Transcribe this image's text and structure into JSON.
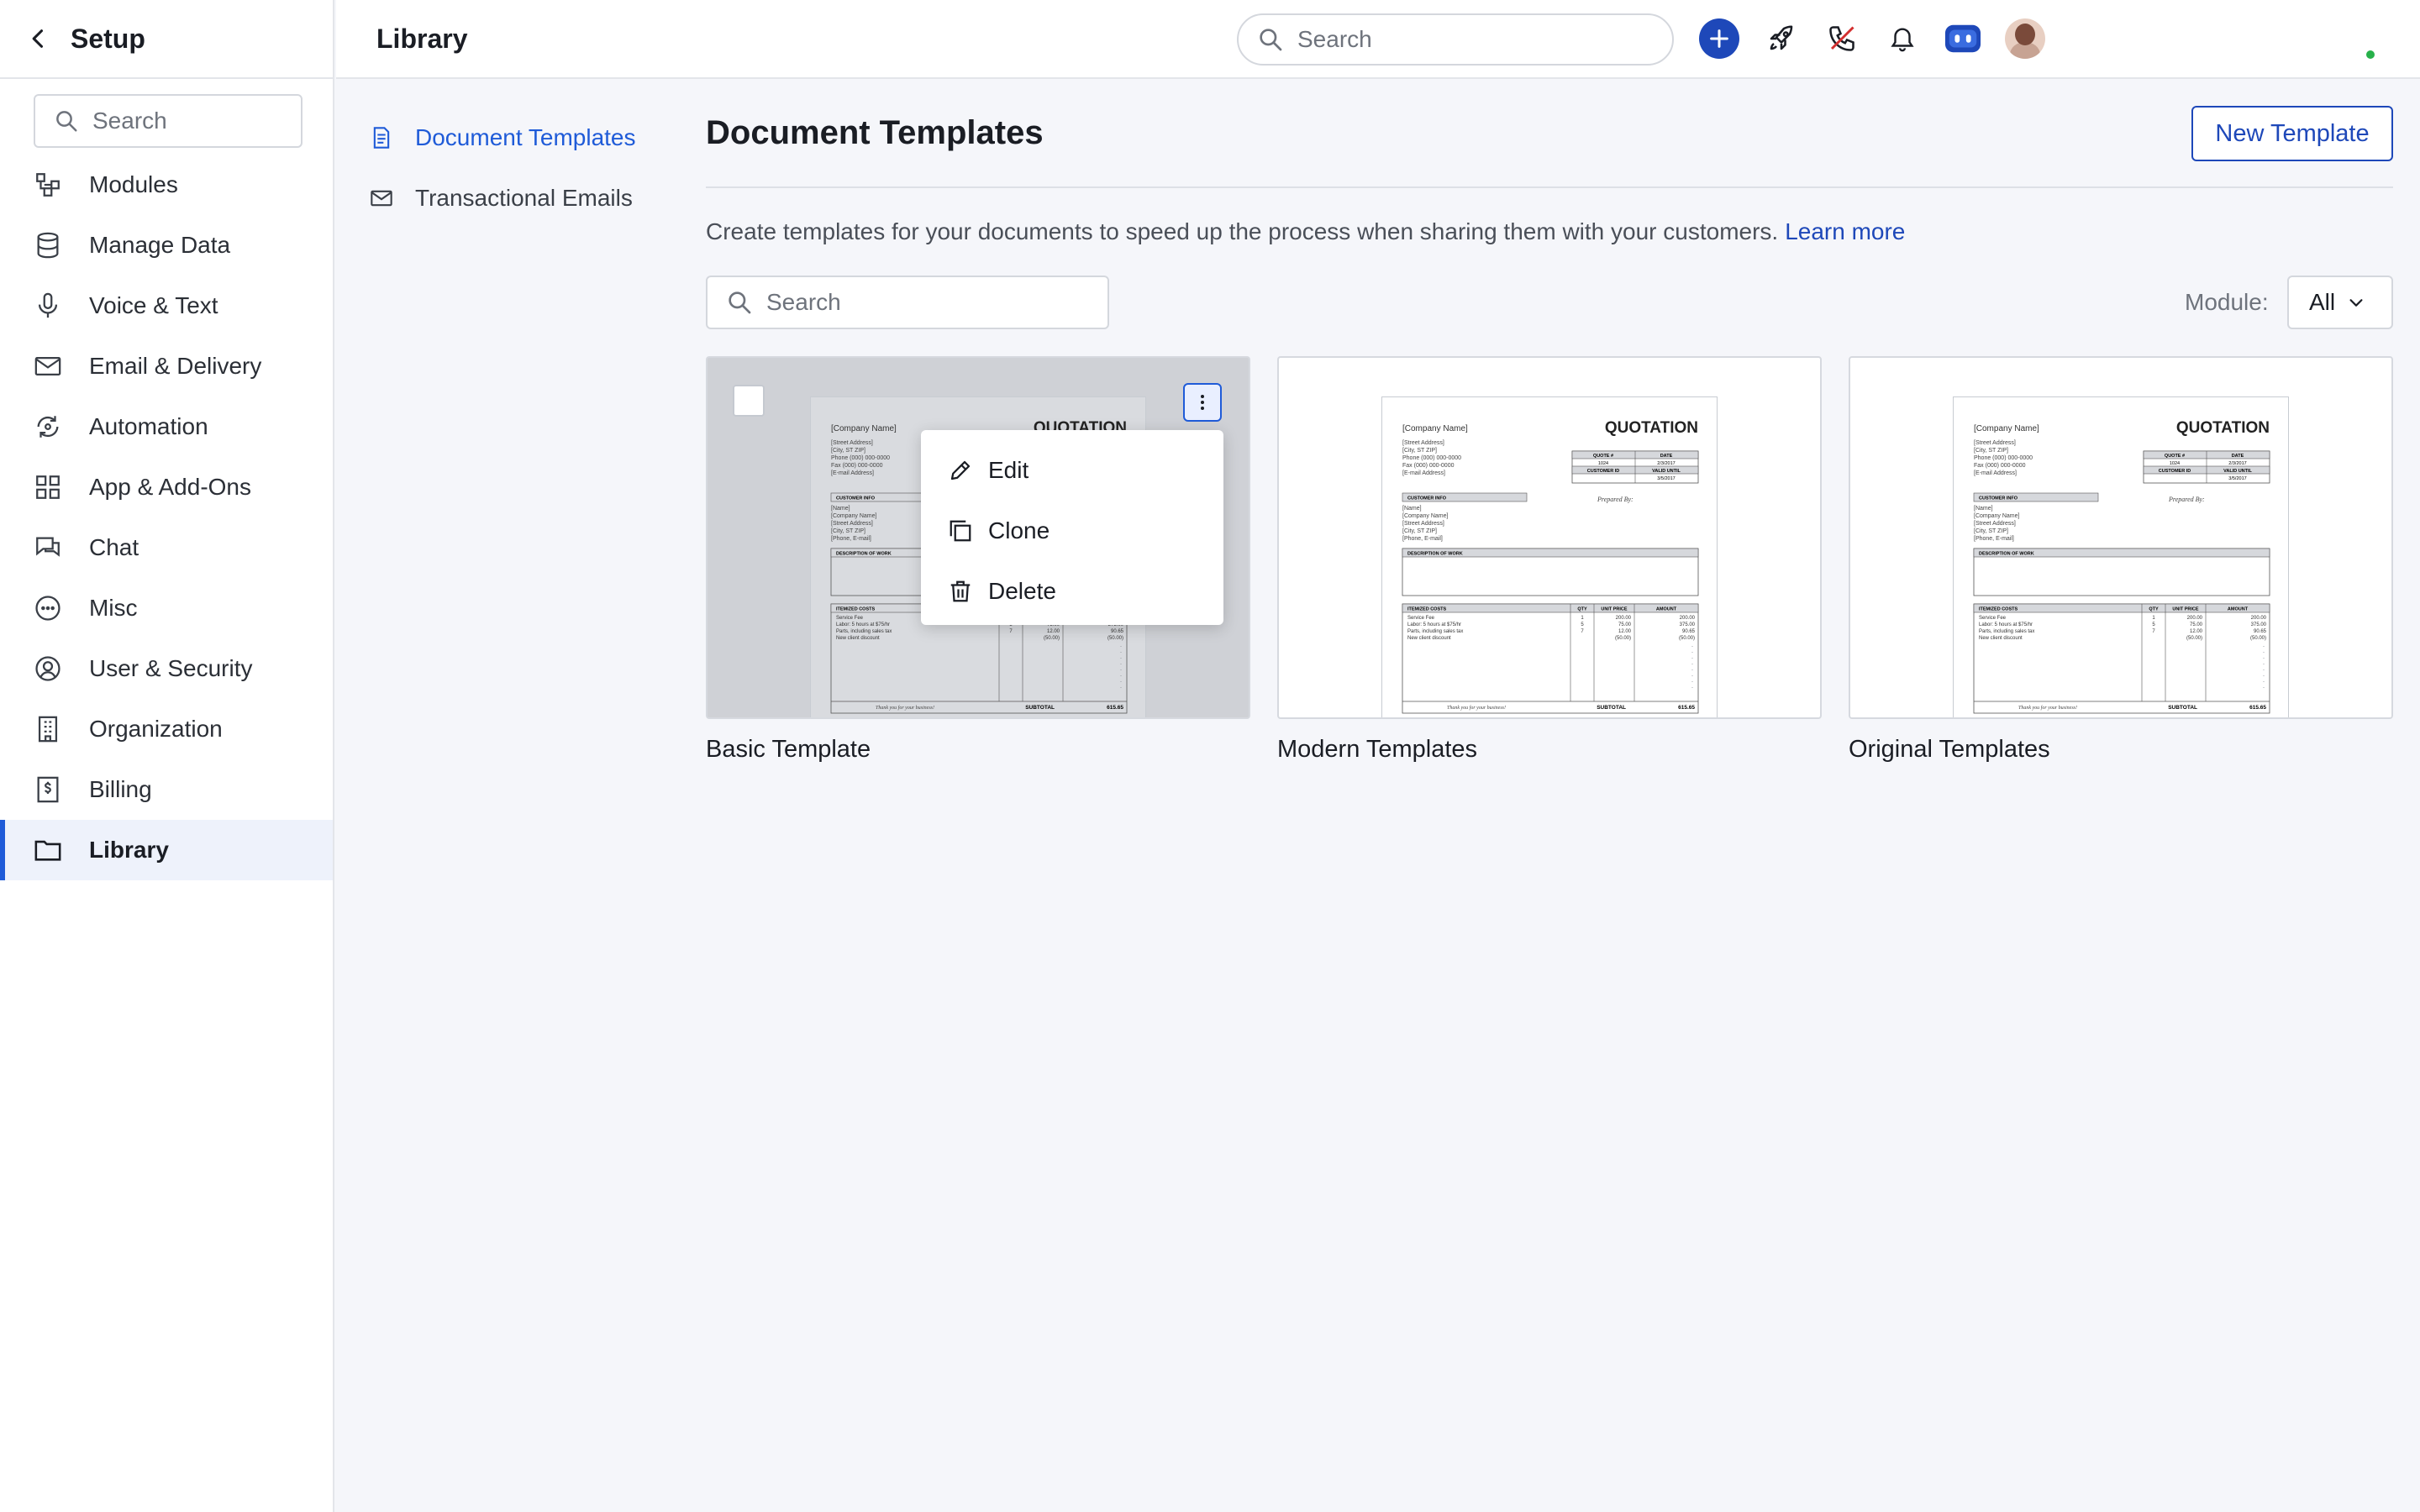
{
  "sidebar": {
    "title": "Setup",
    "search_placeholder": "Search",
    "items": [
      {
        "label": "Modules",
        "icon": "modules-icon"
      },
      {
        "label": "Manage Data",
        "icon": "database-icon"
      },
      {
        "label": "Voice & Text",
        "icon": "microphone-icon"
      },
      {
        "label": "Email & Delivery",
        "icon": "envelope-icon"
      },
      {
        "label": "Automation",
        "icon": "automation-icon"
      },
      {
        "label": "App & Add-Ons",
        "icon": "grid-icon"
      },
      {
        "label": "Chat",
        "icon": "chat-icon"
      },
      {
        "label": "Misc",
        "icon": "ellipsis-circle-icon"
      },
      {
        "label": "User & Security",
        "icon": "user-circle-icon"
      },
      {
        "label": "Organization",
        "icon": "building-icon"
      },
      {
        "label": "Billing",
        "icon": "billing-icon"
      },
      {
        "label": "Library",
        "icon": "folder-icon"
      }
    ],
    "active_index": 11
  },
  "topbar": {
    "breadcrumb": "Library",
    "search_placeholder": "Search"
  },
  "subnav": {
    "items": [
      {
        "label": "Document Templates",
        "icon": "document-icon"
      },
      {
        "label": "Transactional Emails",
        "icon": "envelope-icon"
      }
    ],
    "active_index": 0
  },
  "main": {
    "title": "Document Templates",
    "new_button": "New Template",
    "description": "Create templates for your documents to speed up the process when sharing them with your customers.",
    "learn_more": "Learn more",
    "search_placeholder": "Search",
    "module_label": "Module:",
    "module_value": "All"
  },
  "cards": [
    {
      "name": "Basic Template"
    },
    {
      "name": "Modern Templates"
    },
    {
      "name": "Original Templates"
    }
  ],
  "doc_preview": {
    "company": "[Company Name]",
    "heading": "QUOTATION",
    "address_lines": [
      "[Street Address]",
      "[City, ST ZIP]",
      "Phone (000) 000-0000",
      "Fax (000) 000-0000",
      "[E-mail Address]"
    ],
    "quote_hdr": "QUOTE #",
    "date_hdr": "DATE",
    "quote_num": "1024",
    "date_val": "2/3/2017",
    "cust_id_hdr": "CUSTOMER ID",
    "valid_hdr": "VALID UNTIL",
    "valid_val": "3/5/2017",
    "customer_info": "CUSTOMER INFO",
    "prepared_by": "Prepared By:",
    "customer_lines": [
      "[Name]",
      "[Company Name]",
      "[Street Address]",
      "[City, ST ZIP]",
      "[Phone, E-mail]"
    ],
    "desc_work": "DESCRIPTION OF WORK",
    "itemized": "ITEMIZED COSTS",
    "qty": "QTY",
    "unit_price": "UNIT PRICE",
    "amount": "AMOUNT",
    "rows": [
      [
        "Service Fee",
        "1",
        "200.00",
        "200.00"
      ],
      [
        "Labor: 5 hours at $75/hr",
        "5",
        "75.00",
        "375.00"
      ],
      [
        "Parts, including sales tax",
        "7",
        "12.00",
        "90.65"
      ],
      [
        "New client discount",
        "",
        "(50.00)",
        "(50.00)"
      ]
    ],
    "thanks": "Thank you for your business!",
    "subtotal_label": "SUBTOTAL",
    "subtotal": "615.65"
  },
  "context_menu": {
    "items": [
      {
        "label": "Edit",
        "icon": "pencil-icon"
      },
      {
        "label": "Clone",
        "icon": "clone-icon"
      },
      {
        "label": "Delete",
        "icon": "trash-icon"
      }
    ]
  },
  "colors": {
    "accent": "#1f5bd8",
    "primary_button": "#1e48b9",
    "active_nav_bg": "#eef2fb"
  }
}
